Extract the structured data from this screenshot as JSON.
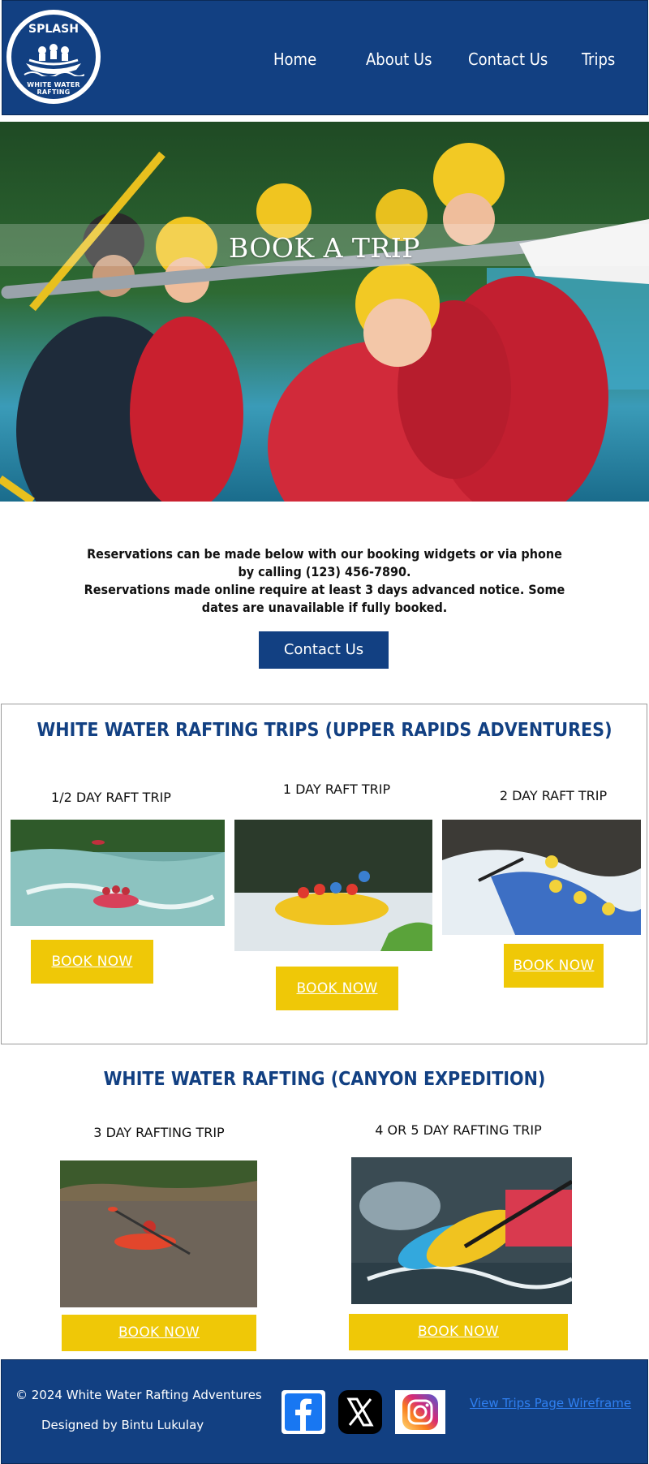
{
  "logo": {
    "top_text": "SPLASH",
    "bottom_text": "WHITE WATER RAFTING"
  },
  "nav": {
    "items": [
      {
        "label": "Home"
      },
      {
        "label": "About Us"
      },
      {
        "label": "Contact Us"
      },
      {
        "label": "Trips"
      }
    ]
  },
  "hero": {
    "title": "BOOK A TRIP"
  },
  "intro": {
    "line1": "Reservations can be made below with our booking widgets or via phone by calling (123) 456-7890.",
    "line2": "Reservations made online require at least 3 days advanced notice. Some dates are unavailable if fully booked.",
    "contact_button": "Contact Us"
  },
  "upper_rapids": {
    "title": "WHITE WATER RAFTING TRIPS (UPPER RAPIDS ADVENTURES)",
    "trips": [
      {
        "label": "1/2 DAY RAFT TRIP",
        "button": "BOOK NOW"
      },
      {
        "label": "1 DAY RAFT TRIP",
        "button": "BOOK NOW"
      },
      {
        "label": "2 DAY RAFT TRIP",
        "button": "BOOK NOW"
      }
    ]
  },
  "canyon": {
    "title": "WHITE WATER RAFTING (CANYON EXPEDITION)",
    "trips": [
      {
        "label": "3 DAY RAFTING TRIP",
        "button": "BOOK NOW"
      },
      {
        "label": "4 OR 5 DAY RAFTING TRIP",
        "button": "BOOK NOW"
      }
    ]
  },
  "footer": {
    "copyright": "© 2024 White Water Rafting Adventures",
    "designer": "Designed by Bintu Lukulay",
    "wireframe_link": "View Trips Page Wireframe",
    "social": [
      "facebook-icon",
      "x-icon",
      "instagram-icon"
    ]
  },
  "colors": {
    "brand_blue": "#124082",
    "accent_yellow": "#efc807",
    "link_blue": "#2f7ff0"
  }
}
